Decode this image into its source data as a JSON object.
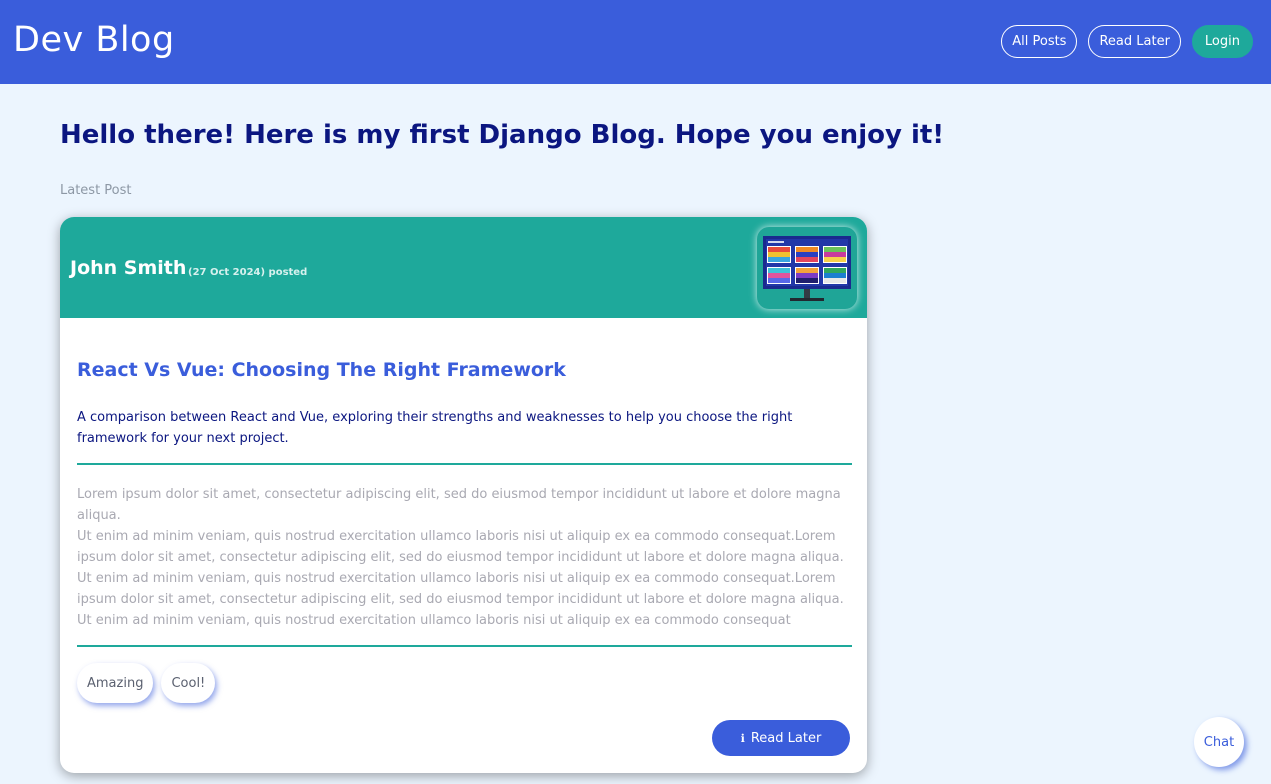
{
  "header": {
    "brand": "Dev Blog",
    "nav": [
      {
        "label": "All Posts"
      },
      {
        "label": "Read Later"
      },
      {
        "label": "Login"
      }
    ]
  },
  "colors": {
    "header_bg": "#3a5ddb",
    "page_bg": "#ecf5fe",
    "accent_teal": "#1ea99b",
    "headline": "#0b1680"
  },
  "main": {
    "headline": "Hello there! Here is my first Django Blog. Hope you enjoy it!",
    "section_label": "Latest Post"
  },
  "post": {
    "author": "John Smith",
    "date": "(27 Oct 2024) posted",
    "thumbnail_icon": "monitor-color-palettes-image",
    "title": "React Vs Vue: Choosing The Right Framework",
    "summary": "A comparison between React and Vue, exploring their strengths and weaknesses to help you choose the right framework for your next project.",
    "body": "Lorem ipsum dolor sit amet, consectetur adipiscing elit, sed do eiusmod tempor incididunt ut labore et dolore magna aliqua.\nUt enim ad minim veniam, quis nostrud exercitation ullamco laboris nisi ut aliquip ex ea commodo consequat.Lorem ipsum dolor sit amet, consectetur adipiscing elit, sed do eiusmod tempor incididunt ut labore et dolore magna aliqua. Ut enim ad minim veniam, quis nostrud exercitation ullamco laboris nisi ut aliquip ex ea commodo consequat.Lorem ipsum dolor sit amet, consectetur adipiscing elit, sed do eiusmod tempor incididunt ut labore et dolore magna aliqua.\nUt enim ad minim veniam, quis nostrud exercitation ullamco laboris nisi ut aliquip ex ea commodo consequat",
    "tags": [
      {
        "label": "Amazing"
      },
      {
        "label": "Cool!"
      }
    ],
    "read_later_icon": "info-icon",
    "read_later_label": "Read Later"
  },
  "chat": {
    "label": "Chat"
  }
}
